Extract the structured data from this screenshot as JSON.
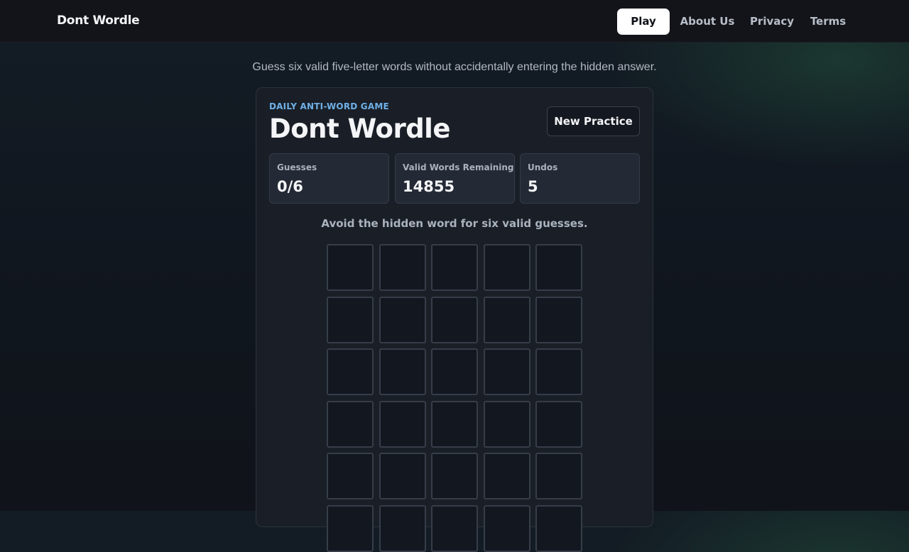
{
  "header": {
    "brand": "Dont Wordle",
    "nav": [
      {
        "label": "Play",
        "active": true
      },
      {
        "label": "About Us",
        "active": false
      },
      {
        "label": "Privacy",
        "active": false
      },
      {
        "label": "Terms",
        "active": false
      }
    ]
  },
  "subtitle": "Guess six valid five-letter words without accidentally entering the hidden answer.",
  "card": {
    "eyebrow": "DAILY ANTI-WORD GAME",
    "title": "Dont Wordle",
    "practice_button": "New Practice",
    "stats": [
      {
        "label": "Guesses",
        "value": "0/6"
      },
      {
        "label": "Valid Words Remaining",
        "value": "14855"
      },
      {
        "label": "Undos",
        "value": "5"
      }
    ],
    "hint": "Avoid the hidden word for six valid guesses.",
    "board": {
      "rows": [
        [
          "",
          "",
          "",
          "",
          ""
        ],
        [
          "",
          "",
          "",
          "",
          ""
        ],
        [
          "",
          "",
          "",
          "",
          ""
        ],
        [
          "",
          "",
          "",
          "",
          ""
        ],
        [
          "",
          "",
          "",
          "",
          ""
        ],
        [
          "",
          "",
          "",
          "",
          ""
        ]
      ]
    }
  },
  "colors": {
    "accent": "#6fb0e6",
    "active_nav_bg": "#ffffff",
    "card_bg": "#1a1f27",
    "tile_border": "#363d49"
  }
}
